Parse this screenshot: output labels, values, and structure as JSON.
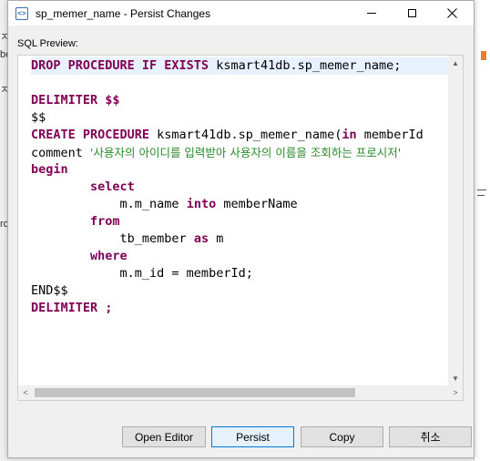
{
  "window": {
    "title": "sp_memer_name - Persist Changes",
    "icon_glyph": "<>"
  },
  "background_app": {
    "left_chars": [
      "ㅈ",
      "be",
      "ㅈ",
      "ro"
    ]
  },
  "sql_preview_label": "SQL Preview:",
  "code_lines": [
    [
      {
        "t": "DROP PROCEDURE IF EXISTS ",
        "c": "kw"
      },
      {
        "t": "ksmart41db.sp_memer_name;",
        "c": "id"
      }
    ],
    [],
    [
      {
        "t": "DELIMITER $$",
        "c": "kw"
      }
    ],
    [
      {
        "t": "$$",
        "c": "id"
      }
    ],
    [
      {
        "t": "CREATE PROCEDURE ",
        "c": "kw"
      },
      {
        "t": "ksmart41db.sp_memer_name(",
        "c": "id"
      },
      {
        "t": "in",
        "c": "kw"
      },
      {
        "t": " memberId",
        "c": "id"
      }
    ],
    [
      {
        "t": "comment ",
        "c": "id"
      },
      {
        "t": "'사용자의 아이디를 입력받아 사용자의 이름을 조회하는 프로시저'",
        "c": "str"
      }
    ],
    [
      {
        "t": "begin",
        "c": "kw"
      }
    ],
    [
      {
        "t": "        ",
        "c": "id"
      },
      {
        "t": "select",
        "c": "kw"
      }
    ],
    [
      {
        "t": "            m.m_name ",
        "c": "id"
      },
      {
        "t": "into",
        "c": "kw"
      },
      {
        "t": " memberName",
        "c": "id"
      }
    ],
    [
      {
        "t": "        ",
        "c": "id"
      },
      {
        "t": "from",
        "c": "kw"
      }
    ],
    [
      {
        "t": "            tb_member ",
        "c": "id"
      },
      {
        "t": "as",
        "c": "kw"
      },
      {
        "t": " m",
        "c": "id"
      }
    ],
    [
      {
        "t": "        ",
        "c": "id"
      },
      {
        "t": "where",
        "c": "kw"
      }
    ],
    [
      {
        "t": "            m.m_id = memberId;",
        "c": "id"
      }
    ],
    [
      {
        "t": "END$$",
        "c": "id"
      }
    ],
    [
      {
        "t": "DELIMITER ;",
        "c": "kw"
      }
    ]
  ],
  "buttons": {
    "open_editor": "Open Editor",
    "persist": "Persist",
    "copy": "Copy",
    "cancel": "취소"
  },
  "colors": {
    "keyword": "#7f0055",
    "string": "#2a8a2a",
    "default_button_border": "#0078d7",
    "current_line": "#e8f2fe"
  }
}
